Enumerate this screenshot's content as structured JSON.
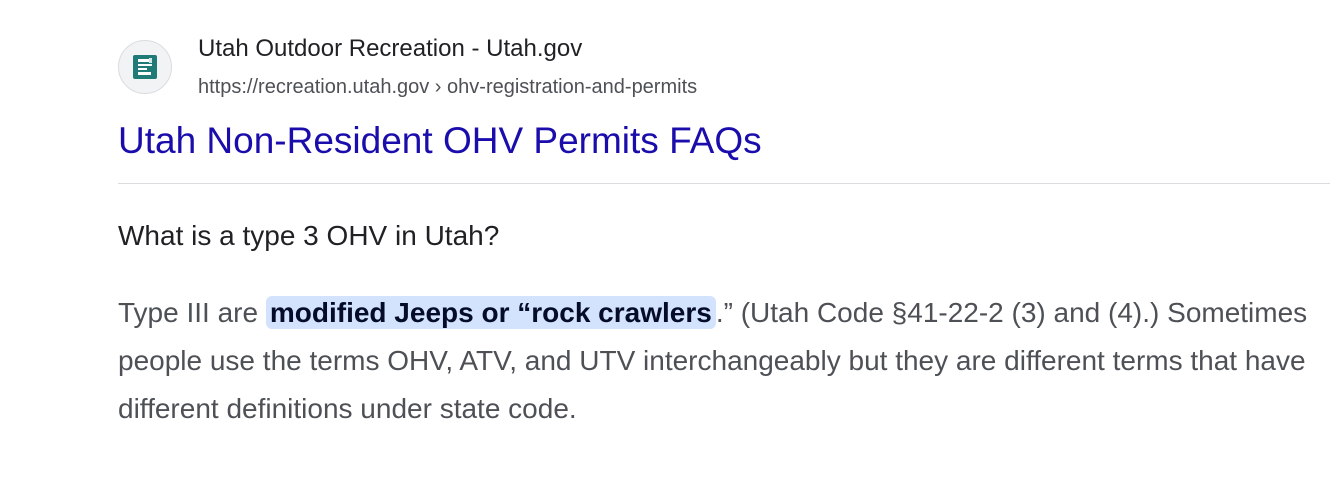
{
  "site": {
    "name": "Utah Outdoor Recreation - Utah.gov",
    "url_base": "https://recreation.utah.gov",
    "url_separator": " › ",
    "url_path": "ohv-registration-and-permits",
    "favicon_icon": "utah-gov-document-icon"
  },
  "result": {
    "title": "Utah Non-Resident OHV Permits FAQs"
  },
  "snippet": {
    "question": "What is a type 3 OHV in Utah?",
    "answer_before": "Type III are ",
    "answer_highlight": "modified Jeeps or “rock crawlers",
    "answer_after": ".” (Utah Code §41-22-2 (3) and (4).) Sometimes people use the terms OHV, ATV, and UTV interchangeably but they are different terms that have different definitions under state code."
  },
  "colors": {
    "title_link": "#1a0dab",
    "highlight_bg": "#d3e3fd",
    "favicon_accent": "#1f7a78"
  }
}
